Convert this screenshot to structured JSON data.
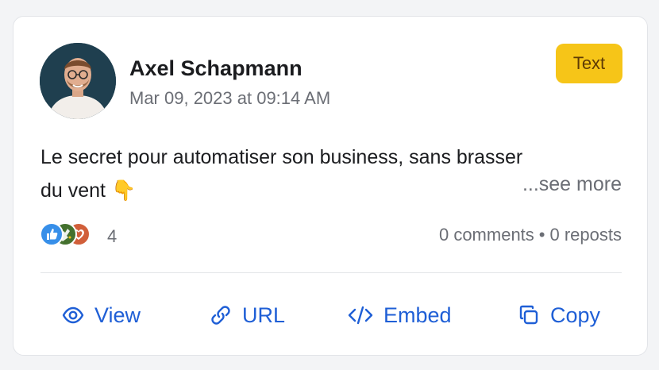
{
  "post": {
    "author": "Axel Schapmann",
    "timestamp": "Mar 09, 2023 at 09:14 AM",
    "type_badge": "Text",
    "text_line1": "Le secret pour automatiser son business, sans brasser",
    "text_line2": "du vent",
    "emoji": "👇",
    "see_more": "...see more"
  },
  "engagement": {
    "reaction_icons": [
      "like-icon",
      "celebrate-icon",
      "love-icon"
    ],
    "reaction_count": "4",
    "comments": "0 comments",
    "separator": "•",
    "reposts": "0 reposts"
  },
  "actions": {
    "view": "View",
    "url": "URL",
    "embed": "Embed",
    "copy": "Copy"
  },
  "colors": {
    "accent": "#1f5fd6",
    "badge_bg": "#f6c518",
    "badge_text": "#5e3b05",
    "muted_text": "#6b6e75"
  }
}
